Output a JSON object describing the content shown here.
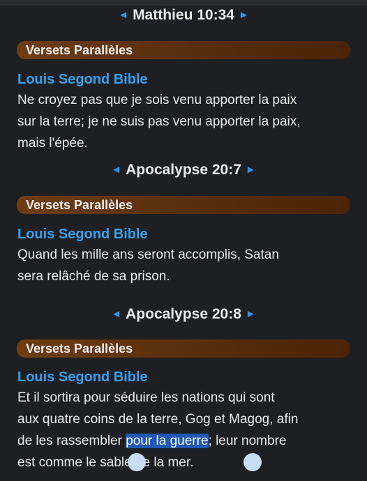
{
  "nav_arrow_left": "◄",
  "nav_arrow_right": "►",
  "accent_color": "#2f93e6",
  "section_bar_color": "#6e3d12",
  "passages": [
    {
      "reference": "Matthieu 10:34",
      "section_title": "Versets Parallèles",
      "bible": "Louis Segond Bible",
      "verse_lines": [
        "Ne croyez pas que je sois venu apporter la paix",
        "sur la terre; je ne suis pas venu apporter la paix,",
        "mais l'épée."
      ]
    },
    {
      "reference": "Apocalypse 20:7",
      "section_title": "Versets Parallèles",
      "bible": "Louis Segond Bible",
      "verse_lines": [
        "Quand les mille ans seront accomplis, Satan",
        "sera relâché de sa prison."
      ]
    },
    {
      "reference": "Apocalypse 20:8",
      "section_title": "Versets Parallèles",
      "bible": "Louis Segond Bible",
      "verse_line_1": "Et il sortira pour séduire les nations qui sont",
      "verse_line_2": "aux quatre coins de la terre, Gog et Magog, afin",
      "verse_line_3_before": "de les rassembler ",
      "verse_line_3_selected": "pour la guerre",
      "verse_line_3_after": "; leur nombre",
      "verse_line_4": "est comme le sable de la mer."
    }
  ]
}
